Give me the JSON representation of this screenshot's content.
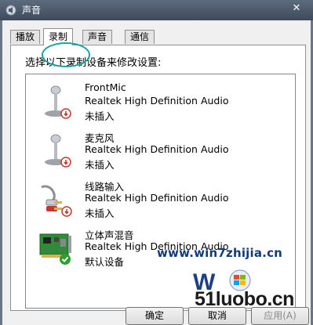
{
  "window": {
    "title": "声音",
    "close_glyph": "✕"
  },
  "tabs": [
    {
      "label": "播放",
      "active": false
    },
    {
      "label": "录制",
      "active": true
    },
    {
      "label": "声音",
      "active": false
    },
    {
      "label": "通信",
      "active": false
    }
  ],
  "panel": {
    "instruction": "选择以下录制设备来修改设置:"
  },
  "devices": [
    {
      "name": "FrontMic",
      "driver": "Realtek High Definition Audio",
      "status": "未插入",
      "icon": "microphone-icon"
    },
    {
      "name": "麦克风",
      "driver": "Realtek High Definition Audio",
      "status": "未插入",
      "icon": "microphone-icon"
    },
    {
      "name": "线路输入",
      "driver": "Realtek High Definition Audio",
      "status": "未插入",
      "icon": "line-in-cable-icon"
    },
    {
      "name": "立体声混音",
      "driver": "Realtek High Definition Audio",
      "status": "默认设备",
      "icon": "sound-card-icon"
    }
  ],
  "watermarks": {
    "site1": "www.win7zhijia.cn",
    "site2": "51luobo.cn"
  },
  "buttons": {
    "ok": "确定",
    "cancel": "取消",
    "apply": "应用(A)"
  },
  "colors": {
    "highlight_circle": "#1aa3a3",
    "titlebar": "#3e4a5a",
    "default_check": "#2e9e2e",
    "unplugged_arrow": "#c0392b"
  }
}
